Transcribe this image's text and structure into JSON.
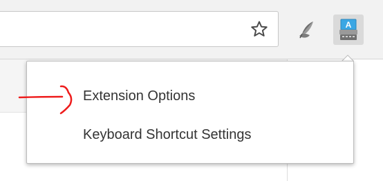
{
  "toolbar": {
    "icons": [
      "star-icon",
      "extension-icon-quill",
      "extension-icon-typewriter"
    ]
  },
  "context_menu": {
    "items": [
      {
        "label": "Extension Options"
      },
      {
        "label": "Keyboard Shortcut Settings"
      }
    ]
  },
  "annotation": {
    "icon": "red-arrow-icon",
    "color": "#ee1c1c"
  },
  "colors": {
    "toolbar_bg": "#f2f2f2",
    "menu_text": "#333333",
    "extension_accent": "#3ba7e4"
  }
}
